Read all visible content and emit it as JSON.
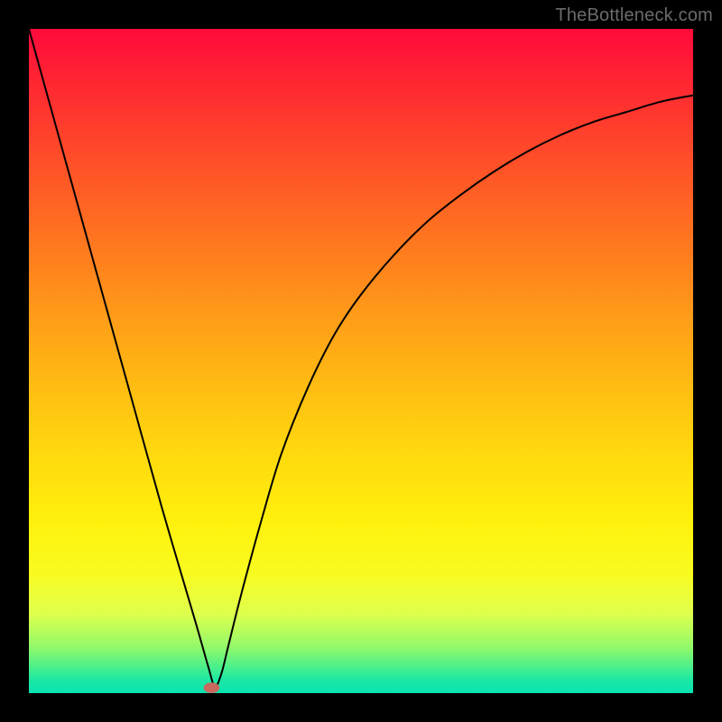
{
  "watermark": "TheBottleneck.com",
  "chart_data": {
    "type": "line",
    "title": "",
    "xlabel": "",
    "ylabel": "",
    "xlim": [
      0,
      100
    ],
    "ylim": [
      0,
      100
    ],
    "grid": false,
    "series": [
      {
        "name": "curve",
        "x": [
          0,
          5,
          10,
          15,
          20,
          25,
          27,
          28,
          29,
          30,
          32,
          35,
          38,
          42,
          46,
          50,
          55,
          60,
          65,
          70,
          75,
          80,
          85,
          90,
          95,
          100
        ],
        "y": [
          100,
          82,
          64,
          46,
          28,
          11,
          4,
          1,
          3,
          7,
          15,
          26,
          36,
          46,
          54,
          60,
          66,
          71,
          75,
          78.5,
          81.5,
          84,
          86,
          87.5,
          89,
          90
        ]
      }
    ],
    "marker": {
      "x": 27.5,
      "y": 0.8,
      "rx": 1.2,
      "ry": 0.8,
      "color": "#c9695e"
    },
    "curve_color": "#000000",
    "curve_width": 2
  }
}
